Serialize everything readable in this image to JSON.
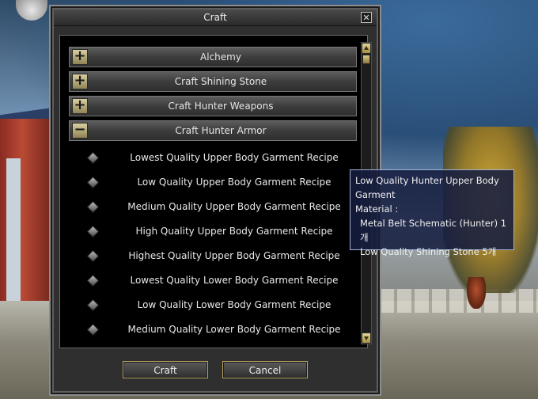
{
  "window": {
    "title": "Craft",
    "close_glyph": "✕"
  },
  "categories": [
    {
      "label": "Alchemy",
      "state": "collapsed",
      "icon": "plus-icon"
    },
    {
      "label": "Craft Shining Stone",
      "state": "collapsed",
      "icon": "plus-icon"
    },
    {
      "label": "Craft Hunter Weapons",
      "state": "collapsed",
      "icon": "plus-icon"
    },
    {
      "label": "Craft Hunter Armor",
      "state": "expanded",
      "icon": "minus-icon"
    }
  ],
  "recipes": [
    "Lowest Quality Upper Body Garment Recipe",
    "Low Quality Upper Body Garment Recipe",
    "Medium Quality Upper Body Garment Recipe",
    "High Quality Upper Body Garment Recipe",
    "Highest Quality Upper Body Garment Recipe",
    "Lowest Quality Lower Body Garment Recipe",
    "Low Quality Lower Body Garment Recipe",
    "Medium Quality Lower Body Garment Recipe"
  ],
  "buttons": {
    "craft": "Craft",
    "cancel": "Cancel"
  },
  "tooltip": {
    "title": "Low Quality Hunter Upper Body Garment",
    "material_label": "Material :",
    "materials": [
      "Metal Belt Schematic (Hunter) 1개",
      "Low Quality Shining Stone 5개"
    ]
  },
  "colors": {
    "window_bg": "#2f2f2f",
    "button_border": "#b8a35c",
    "tooltip_bg": "#161e40"
  }
}
